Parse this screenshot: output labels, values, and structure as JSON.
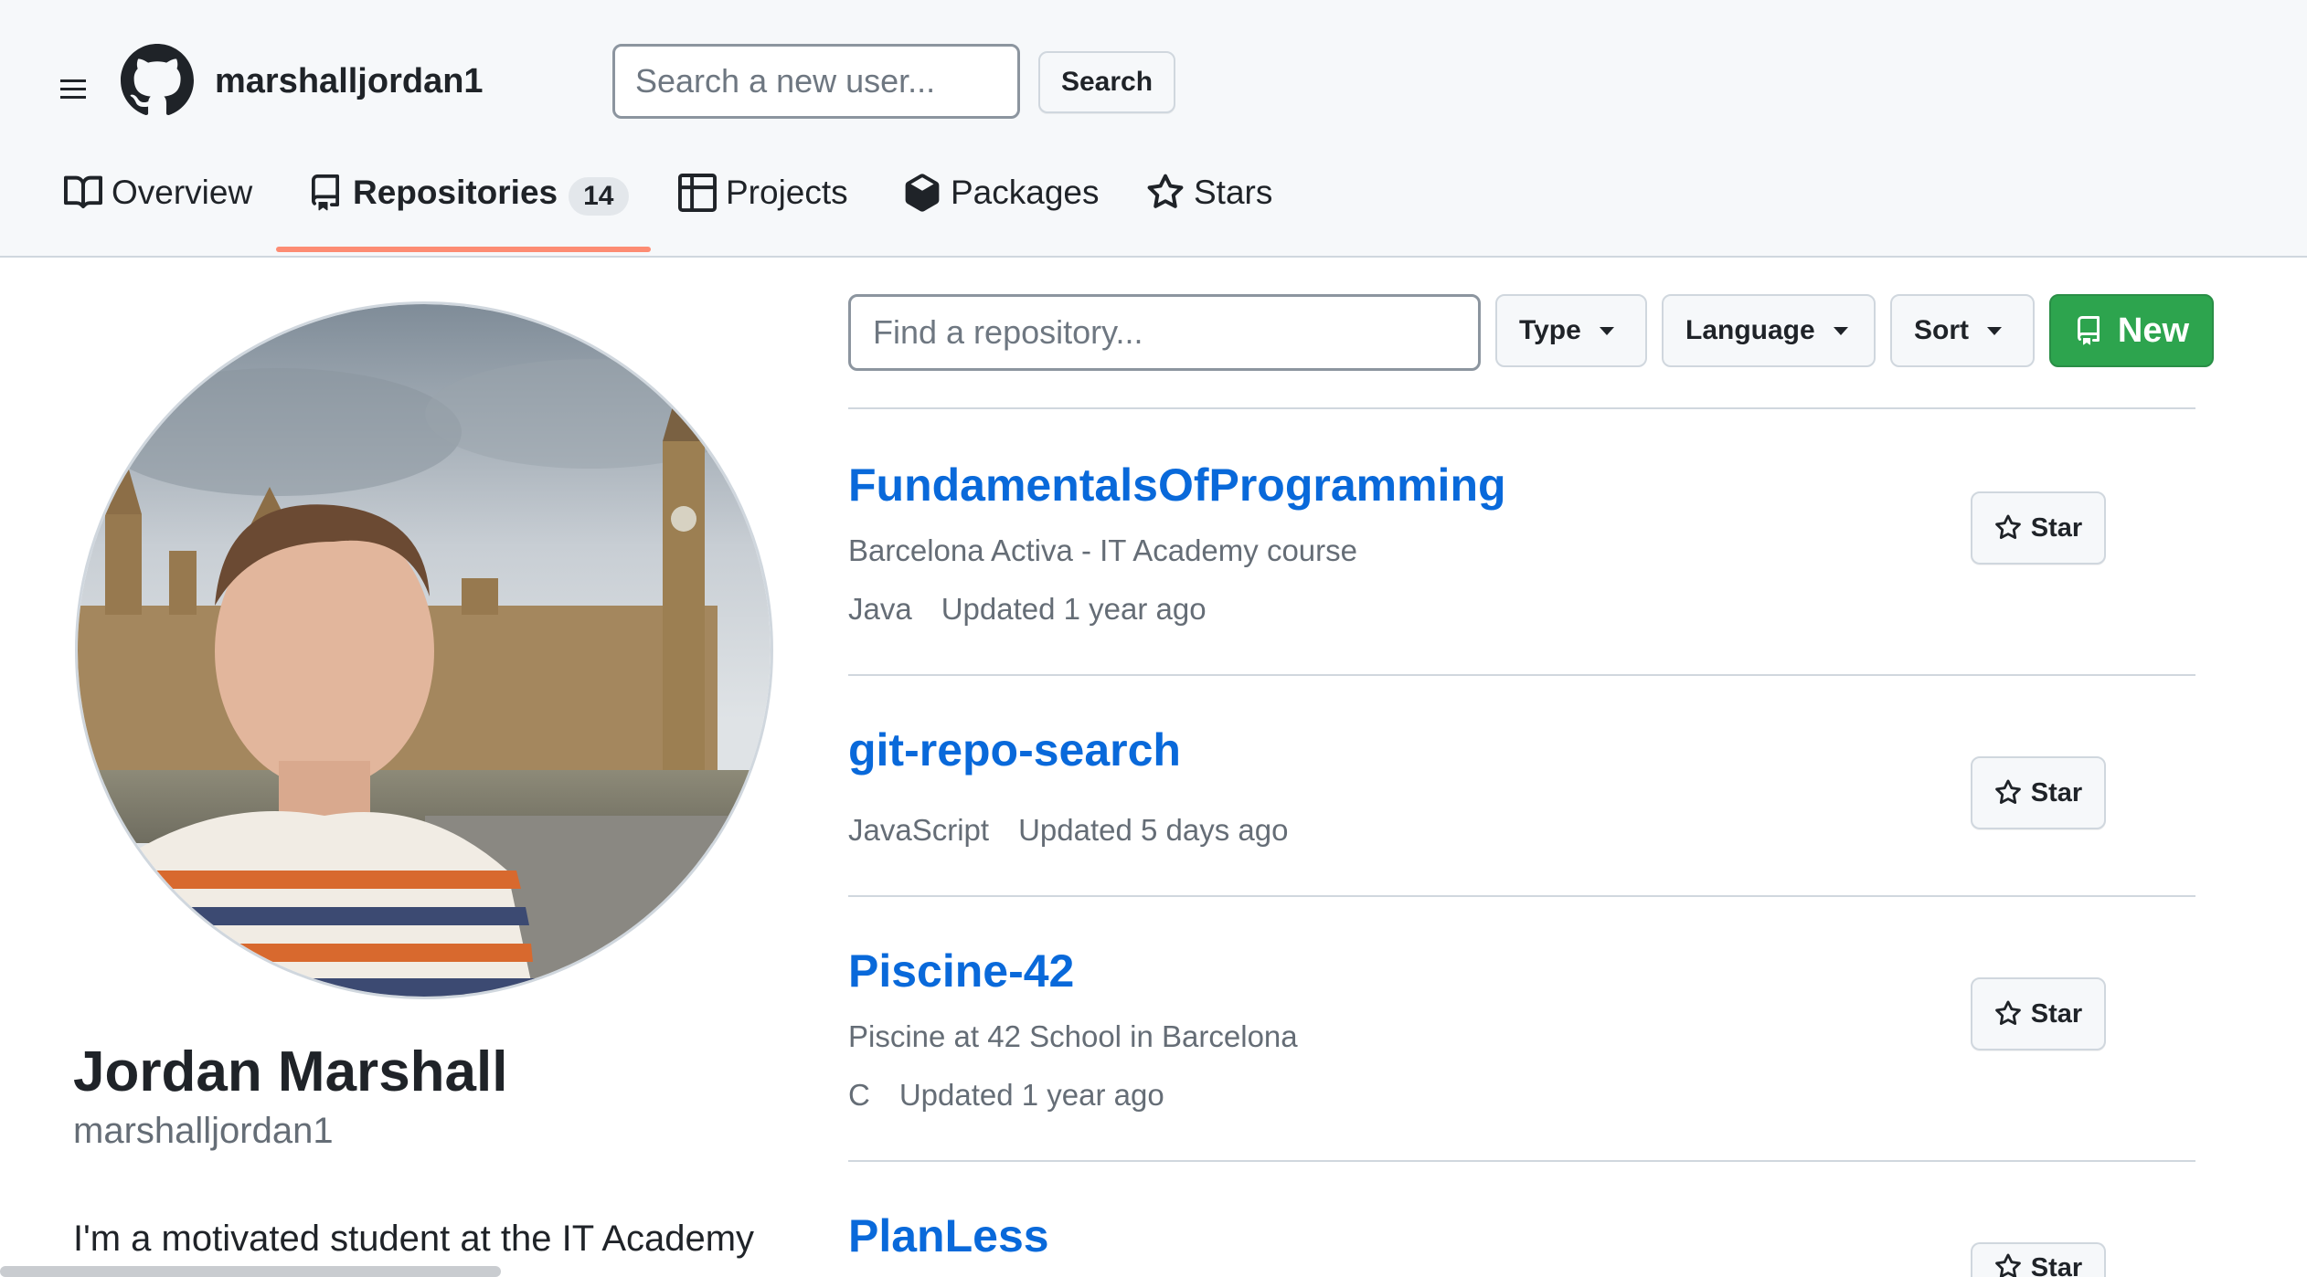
{
  "header": {
    "username": "marshalljordan1",
    "search_placeholder": "Search a new user...",
    "search_button": "Search"
  },
  "tabs": [
    {
      "label": "Overview",
      "icon": "book-icon"
    },
    {
      "label": "Repositories",
      "icon": "repo-icon",
      "count": "14",
      "active": true
    },
    {
      "label": "Projects",
      "icon": "table-icon"
    },
    {
      "label": "Packages",
      "icon": "package-icon"
    },
    {
      "label": "Stars",
      "icon": "star-icon"
    }
  ],
  "profile": {
    "full_name": "Jordan Marshall",
    "login": "marshalljordan1",
    "bio": "I'm a motivated student at the IT Academy"
  },
  "repo_toolbar": {
    "find_placeholder": "Find a repository...",
    "type_label": "Type",
    "language_label": "Language",
    "sort_label": "Sort",
    "new_label": "New"
  },
  "repos": [
    {
      "name": "FundamentalsOfProgramming",
      "description": "Barcelona Activa - IT Academy course",
      "language": "Java",
      "updated": "Updated 1 year ago",
      "star_label": "Star"
    },
    {
      "name": "git-repo-search",
      "description": "",
      "language": "JavaScript",
      "updated": "Updated 5 days ago",
      "star_label": "Star"
    },
    {
      "name": "Piscine-42",
      "description": "Piscine at 42 School in Barcelona",
      "language": "C",
      "updated": "Updated 1 year ago",
      "star_label": "Star"
    },
    {
      "name": "PlanLess",
      "description": "",
      "language": "",
      "updated": "",
      "star_label": "Star"
    }
  ],
  "colors": {
    "accent_link": "#0969da",
    "new_button": "#2da44e",
    "tab_underline": "#fd8c73"
  }
}
